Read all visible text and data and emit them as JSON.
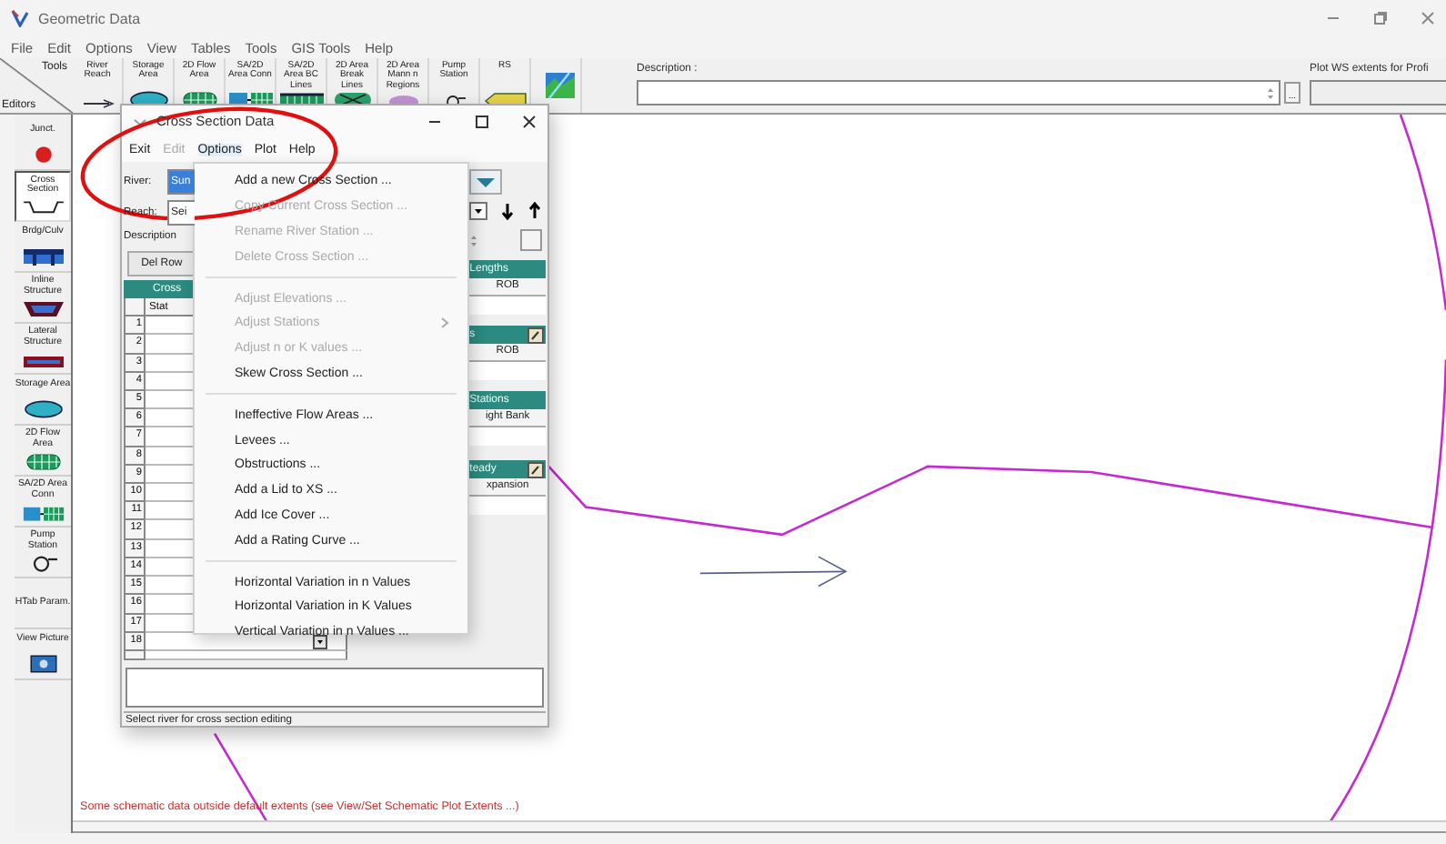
{
  "window": {
    "title": "Geometric Data"
  },
  "menu": [
    "File",
    "Edit",
    "Options",
    "View",
    "Tables",
    "Tools",
    "GIS Tools",
    "Help"
  ],
  "toolbar": {
    "tools_label": "Tools",
    "editors_label": "Editors",
    "buttons": [
      {
        "label": "River Reach",
        "kind": "reach"
      },
      {
        "label": "Storage Area",
        "kind": "storage"
      },
      {
        "label": "2D Flow Area",
        "kind": "flow"
      },
      {
        "label": "SA/2D Area Conn",
        "kind": "conn"
      },
      {
        "label": "SA/2D Area BC Lines",
        "kind": "bc"
      },
      {
        "label": "2D Area Break Lines",
        "kind": "break"
      },
      {
        "label": "2D Area Mann n Regions",
        "kind": "mann"
      },
      {
        "label": "Pump Station",
        "kind": "pump"
      },
      {
        "label": "RS",
        "kind": "rs"
      },
      {
        "kind": "map"
      }
    ],
    "description": {
      "label": "Description :",
      "button": "..."
    },
    "plot_extents": {
      "label": "Plot WS extents for Profi"
    }
  },
  "editors": [
    {
      "label": "Junct.",
      "kind": "junction",
      "selected": false
    },
    {
      "label": "Cross Section",
      "kind": "xs",
      "selected": true
    },
    {
      "label": "Brdg/Culv",
      "kind": "bridge",
      "selected": false
    },
    {
      "label": "Inline Structure",
      "kind": "inline",
      "selected": false
    },
    {
      "label": "Lateral Structure",
      "kind": "lateral",
      "selected": false
    },
    {
      "label": "Storage Area",
      "kind": "storage",
      "selected": false
    },
    {
      "label": "2D Flow Area",
      "kind": "flow",
      "selected": false
    },
    {
      "label": "SA/2D Area Conn",
      "kind": "conn",
      "selected": false
    },
    {
      "label": "Pump Station",
      "kind": "pump",
      "selected": false
    },
    {
      "label": "HTab Param.",
      "kind": "htab",
      "selected": false
    },
    {
      "label": "View Picture",
      "kind": "picture",
      "selected": false
    }
  ],
  "canvas": {
    "warning": "Some schematic data outside default extents (see View/Set Schematic Plot Extents ...)"
  },
  "dialog": {
    "title": "Cross Section Data",
    "menu": [
      {
        "label": "Exit",
        "disabled": false,
        "open": false
      },
      {
        "label": "Edit",
        "disabled": true,
        "open": false
      },
      {
        "label": "Options",
        "disabled": false,
        "open": true
      },
      {
        "label": "Plot",
        "disabled": false,
        "open": false
      },
      {
        "label": "Help",
        "disabled": false,
        "open": false
      }
    ],
    "options_menu": [
      {
        "kind": "item",
        "label": "Add a new Cross Section ...",
        "disabled": false
      },
      {
        "kind": "item",
        "label": "Copy Current Cross Section ...",
        "disabled": true
      },
      {
        "kind": "item",
        "label": "Rename River Station ...",
        "disabled": true
      },
      {
        "kind": "item",
        "label": "Delete Cross Section ...",
        "disabled": true
      },
      {
        "kind": "separator"
      },
      {
        "kind": "item",
        "label": "Adjust Elevations ...",
        "disabled": true
      },
      {
        "kind": "submenu",
        "label": "Adjust Stations",
        "disabled": true
      },
      {
        "kind": "item",
        "label": "Adjust n or K values ...",
        "disabled": true
      },
      {
        "kind": "item",
        "label": "Skew Cross Section ...",
        "disabled": false
      },
      {
        "kind": "separator"
      },
      {
        "kind": "item",
        "label": "Ineffective Flow Areas ...",
        "disabled": false
      },
      {
        "kind": "item",
        "label": "Levees ...",
        "disabled": false
      },
      {
        "kind": "item",
        "label": "Obstructions ...",
        "disabled": false
      },
      {
        "kind": "item",
        "label": "Add a Lid to XS ...",
        "disabled": false
      },
      {
        "kind": "item",
        "label": "Add Ice Cover ...",
        "disabled": false
      },
      {
        "kind": "item",
        "label": "Add a Rating Curve ...",
        "disabled": false
      },
      {
        "kind": "separator"
      },
      {
        "kind": "item",
        "label": "Horizontal Variation in n Values",
        "disabled": false
      },
      {
        "kind": "item",
        "label": "Horizontal Variation in K Values",
        "disabled": false
      },
      {
        "kind": "item",
        "label": "Vertical Variation in n Values ...",
        "disabled": false
      }
    ],
    "river": {
      "label": "River:",
      "value": "Sun"
    },
    "reach": {
      "label": "Reach:",
      "value": "Sei"
    },
    "description_label": "Description",
    "del_row": "Del Row",
    "table": {
      "title": "Cross",
      "columns": [
        "Stat"
      ],
      "rows": [
        "1",
        "2",
        "3",
        "4",
        "5",
        "6",
        "7",
        "8",
        "9",
        "10",
        "11",
        "12",
        "13",
        "14",
        "15",
        "16",
        "17",
        "18"
      ]
    },
    "lengths": {
      "title": "Lengths",
      "column": "ROB"
    },
    "mannings": {
      "title": "s",
      "column": "ROB"
    },
    "bank_stations": {
      "title": "Stations",
      "column": "ight Bank"
    },
    "coefficients": {
      "title": "teady",
      "column": "xpansion"
    },
    "status": "Select river for cross section editing"
  }
}
